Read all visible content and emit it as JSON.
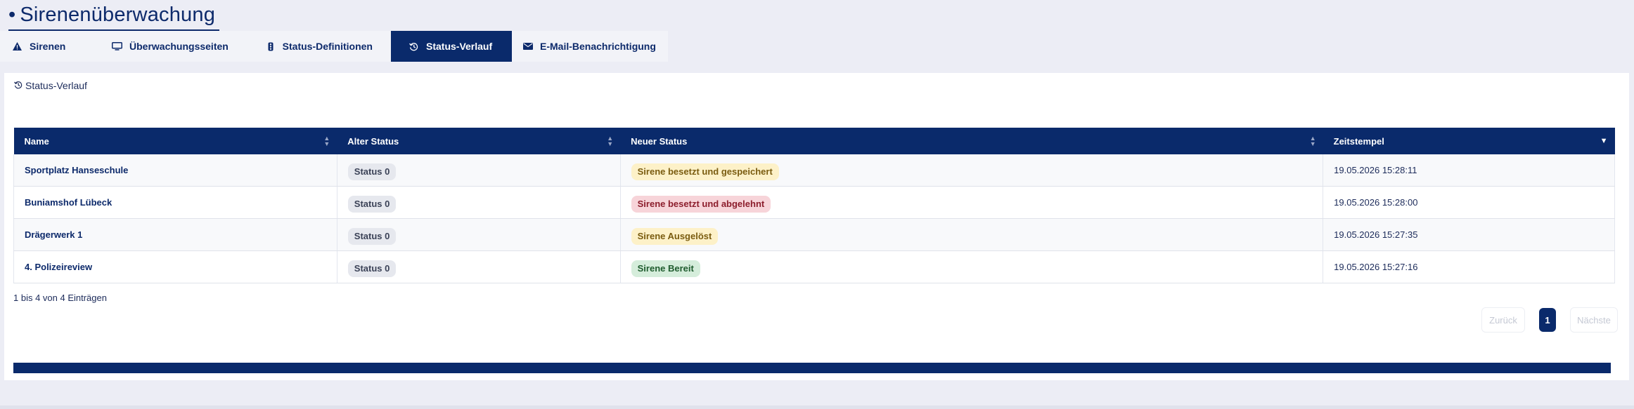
{
  "page_title": "Sirenenüberwachung",
  "tabs": [
    {
      "label": "Sirenen",
      "icon": "warning-triangle-icon",
      "active": false
    },
    {
      "label": "Überwachungsseiten",
      "icon": "monitor-icon",
      "active": false
    },
    {
      "label": "Status-Definitionen",
      "icon": "traffic-light-icon",
      "active": false
    },
    {
      "label": "Status-Verlauf",
      "icon": "history-icon",
      "active": true
    },
    {
      "label": "E-Mail-Benachrichtigung",
      "icon": "envelope-icon",
      "active": false
    }
  ],
  "card": {
    "header": "Status-Verlauf",
    "icon": "history-icon"
  },
  "table": {
    "columns": [
      "Name",
      "Alter Status",
      "Neuer Status",
      "Zeitstempel"
    ],
    "rows": [
      {
        "name": "Sportplatz Hanseschule",
        "old_status": "Status 0",
        "new_status": "Sirene besetzt und gespeichert",
        "new_status_color": "#fdf1c8",
        "timestamp": "19.05.2026 15:28:11"
      },
      {
        "name": "Buniamshof Lübeck",
        "old_status": "Status 0",
        "new_status": "Sirene besetzt und abgelehnt",
        "new_status_color": "#f7d4d9",
        "timestamp": "19.05.2026 15:28:00"
      },
      {
        "name": "Drägerwerk 1",
        "old_status": "Status 0",
        "new_status": "Sirene Ausgelöst",
        "new_status_color": "#fdf1c8",
        "timestamp": "19.05.2026 15:27:35"
      },
      {
        "name": "4. Polizeireview",
        "old_status": "Status 0",
        "new_status": "Sirene Bereit",
        "new_status_color": "#d5eddb",
        "timestamp": "19.05.2026 15:27:16"
      }
    ]
  },
  "table_info": "1 bis 4 von 4 Einträgen",
  "pagination": {
    "prev": "Zurück",
    "page": "1",
    "next": "Nächste"
  },
  "colors": {
    "primary": "#0a2a6b",
    "background": "#ecedf5"
  }
}
